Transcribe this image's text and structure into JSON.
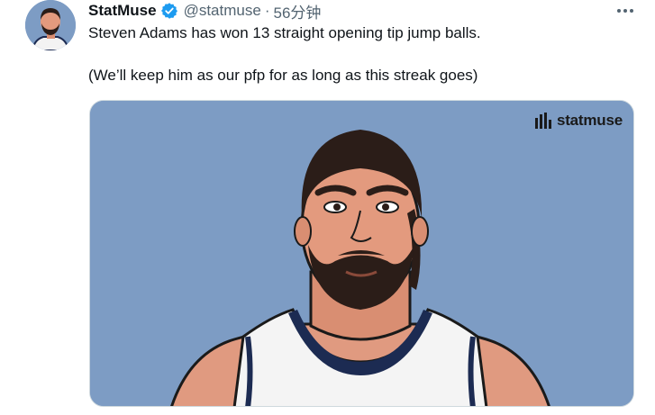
{
  "tweet": {
    "display_name": "StatMuse",
    "handle": "@statmuse",
    "separator": "·",
    "time": "56分钟",
    "text_line1": "Steven Adams has won 13 straight opening tip jump balls.",
    "text_line2": "(We’ll keep him as our pfp for as long as this streak goes)"
  },
  "media": {
    "brand_label": "statmuse",
    "background_color": "#7d9cc4"
  },
  "icons": {
    "verified": "verified-badge-icon",
    "more": "more-options-icon",
    "brand": "statmuse-logo-icon"
  },
  "colors": {
    "verified_blue": "#1d9bf0",
    "secondary_text": "#536471",
    "primary_text": "#0f1419"
  }
}
